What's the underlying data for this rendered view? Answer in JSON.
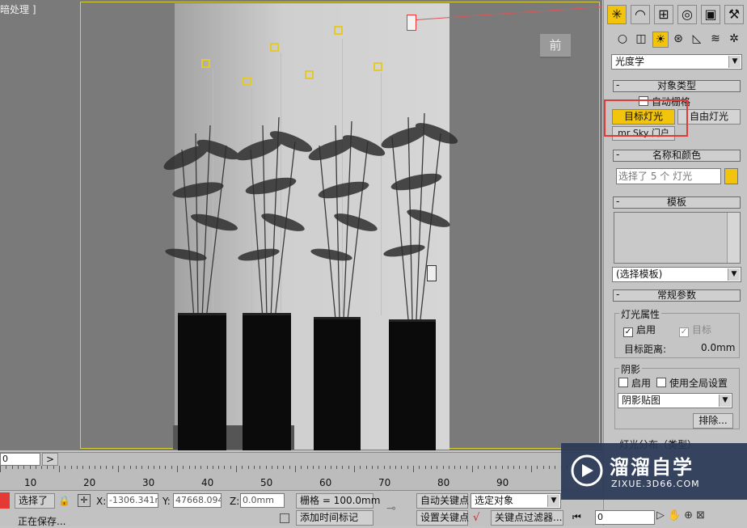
{
  "viewport": {
    "label": "暗处理 ]",
    "viewcube_label": "前"
  },
  "panel": {
    "tab_icons": [
      "create-icon",
      "modify-icon",
      "hierarchy-icon",
      "motion-icon",
      "display-icon",
      "utilities-icon"
    ],
    "category_dropdown": "光度学",
    "rollout_object_type": "对象类型",
    "auto_grid_label": "自动栅格",
    "btn_target_light": "目标灯光",
    "btn_free_light": "自由灯光",
    "btn_mr_sky": "mr Sky 门户",
    "rollout_name_color": "名称和颜色",
    "name_field_value": "选择了 5 个 灯光",
    "name_color": "#f2c40b",
    "rollout_template": "模板",
    "template_dropdown": "(选择模板)",
    "rollout_general": "常规参数",
    "light_props_label": "灯光属性",
    "enable_label": "启用",
    "target_label": "目标",
    "target_distance_label": "目标距离:",
    "target_distance_value": "0.0mm",
    "shadow_label": "阴影",
    "shadow_enable_label": "启用",
    "use_global_label": "使用全局设置",
    "shadow_type": "阴影贴图",
    "exclude_btn": "排除...",
    "light_dist_label": "灯光分布（类型）"
  },
  "timeline": {
    "slider_value": "0",
    "next_arrow": ">",
    "ticks": [
      "10",
      "20",
      "30",
      "40",
      "50",
      "60",
      "70",
      "80",
      "90"
    ]
  },
  "status": {
    "selected_btn": "选择了",
    "x_label": "X:",
    "x_value": "-1306.341r",
    "y_label": "Y:",
    "y_value": "47668.094",
    "z_label": "Z:",
    "z_value": "0.0mm",
    "grid_label": "栅格 = 100.0mm",
    "auto_key": "自动关键点",
    "selected_object": "选定对象",
    "set_key": "设置关键点",
    "key_filter": "关键点过滤器...",
    "saving": "正在保存...",
    "add_time_tag": "添加时间标记",
    "frame_value": "0"
  },
  "watermark": {
    "brand": "溜溜自学",
    "url": "ZIXUE.3D66.COM"
  },
  "colors": {
    "highlight": "#f2c40b",
    "red_box": "#e53935"
  }
}
